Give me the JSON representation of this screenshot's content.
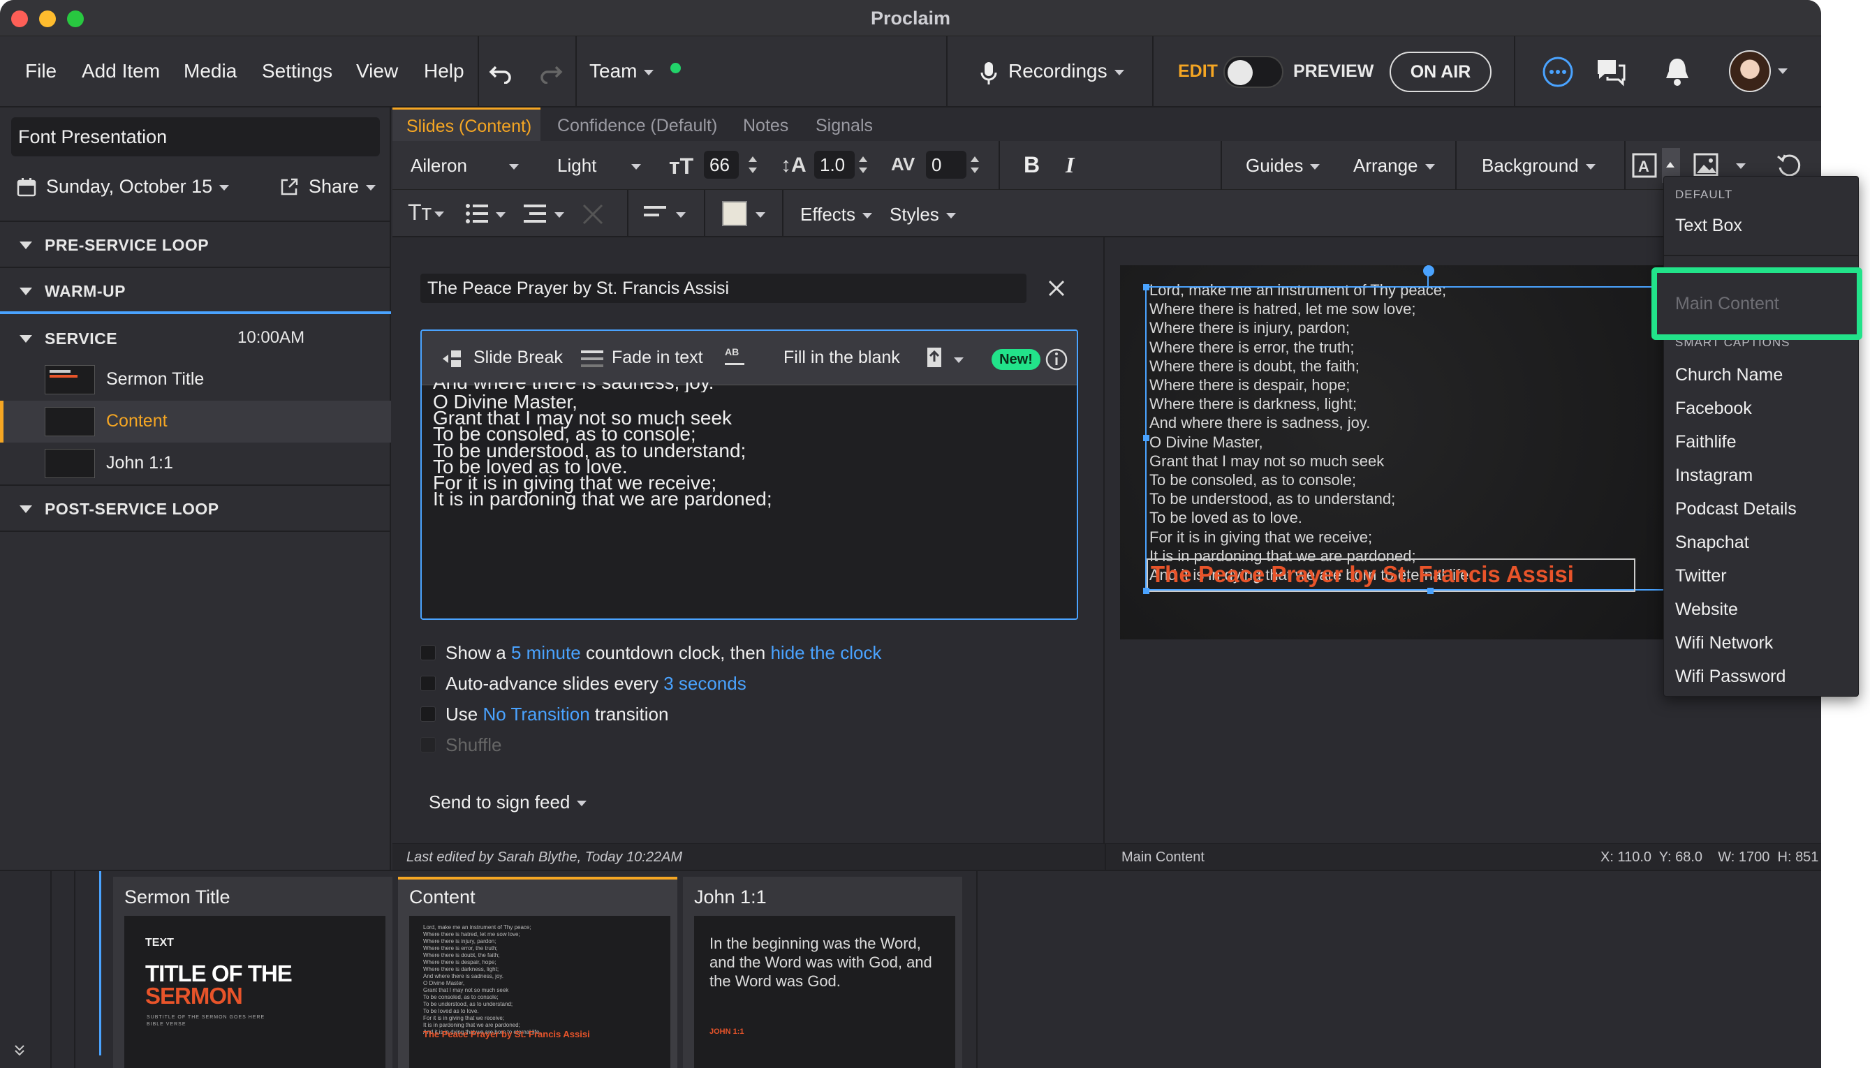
{
  "window": {
    "title": "Proclaim"
  },
  "menu": {
    "file": "File",
    "add_item": "Add Item",
    "media": "Media",
    "settings": "Settings",
    "view": "View",
    "help": "Help",
    "team": "Team",
    "recordings": "Recordings",
    "edit": "EDIT",
    "preview": "PREVIEW",
    "on_air": "ON AIR"
  },
  "sidebar": {
    "presentation_name": "Font Presentation",
    "date": "Sunday, October 15",
    "share": "Share",
    "sections": [
      {
        "label": "PRE-SERVICE LOOP"
      },
      {
        "label": "WARM-UP"
      },
      {
        "label": "SERVICE",
        "time": "10:00AM"
      },
      {
        "label": "POST-SERVICE LOOP"
      }
    ],
    "service_items": [
      {
        "label": "Sermon Title"
      },
      {
        "label": "Content"
      },
      {
        "label": "John 1:1"
      }
    ]
  },
  "tabs": [
    {
      "label": "Slides (Content)"
    },
    {
      "label": "Confidence (Default)"
    },
    {
      "label": "Notes"
    },
    {
      "label": "Signals"
    }
  ],
  "toolbar": {
    "font": "Aileron",
    "weight": "Light",
    "size": "66",
    "line_height": "1.0",
    "tracking": "0",
    "bold": "B",
    "italic": "I",
    "guides": "Guides",
    "arrange": "Arrange",
    "background": "Background",
    "effects": "Effects",
    "styles": "Styles",
    "swatch_color": "#e8e4d8"
  },
  "editor": {
    "slide_title": "The Peace Prayer by St. Francis Assisi",
    "tools": {
      "slide_break": "Slide Break",
      "fade_in": "Fade in text",
      "fill_blank": "Fill in the blank",
      "new_badge": "New!"
    },
    "partial_line": "And where there is sadness, joy.",
    "lines": [
      "O Divine Master,",
      "Grant that I may not so much seek",
      "To be consoled, as to console;",
      "To be understood, as to understand;",
      "To be loved as to love.",
      "For it is in giving that we receive;",
      "It is in pardoning that we are pardoned;"
    ],
    "countdown": {
      "prefix": "Show a",
      "minutes": "5 minute",
      "middle": "countdown clock, then",
      "action": "hide the clock"
    },
    "auto_advance": {
      "prefix": "Auto-advance slides every",
      "seconds": "3 seconds"
    },
    "transition": {
      "prefix": "Use",
      "value": "No Transition",
      "suffix": "transition"
    },
    "shuffle": "Shuffle",
    "send": "Send to sign feed"
  },
  "canvas": {
    "lines": [
      "Lord, make me an instrument of Thy peace;",
      "Where there is hatred, let me sow love;",
      "Where there is injury, pardon;",
      "Where there is error, the truth;",
      "Where there is doubt, the faith;",
      "Where there is despair, hope;",
      "Where there is darkness, light;",
      "And where there is sadness, joy.",
      "O Divine Master,",
      "Grant that I may not so much seek",
      "To be consoled, as to console;",
      "To be understood, as to understand;",
      "To be loved as to love.",
      "For it is in giving that we receive;",
      "It is in pardoning that we are pardoned;",
      "And it is in dying that we are born to eternal life."
    ],
    "overlay_title": "The Peace Prayer by St. Francis Assisi"
  },
  "status": {
    "last_edited": "Last edited by Sarah Blythe, Today 10:22AM",
    "selection": "Main Content",
    "coords": "X: 110.0  Y: 68.0    W: 1700  H: 851"
  },
  "filmstrip": {
    "cards": [
      {
        "title": "Sermon Title",
        "small": "TEXT",
        "big1": "TITLE OF THE",
        "big2": "SERMON",
        "sub": "SUBTITLE OF THE SERMON GOES HERE",
        "sub2": "BIBLE VERSE"
      },
      {
        "title": "Content",
        "overlay": "The Peace Prayer by St. Francis Assisi"
      },
      {
        "title": "John 1:1",
        "body": "In the beginning was the Word, and the Word was with God, and the Word was God.",
        "ref": "JOHN 1:1"
      }
    ]
  },
  "dropdown": {
    "default_header": "DEFAULT",
    "text_box": "Text Box",
    "main_content": "Main Content",
    "smart_header": "SMART CAPTIONS",
    "items": [
      "Church Name",
      "Facebook",
      "Faithlife",
      "Instagram",
      "Podcast Details",
      "Snapchat",
      "Twitter",
      "Website",
      "Wifi Network",
      "Wifi Password"
    ]
  },
  "colors": {
    "accent": "#f5a623",
    "link": "#4aa3ff",
    "highlight": "#22e38a",
    "orange": "#e8542a"
  }
}
